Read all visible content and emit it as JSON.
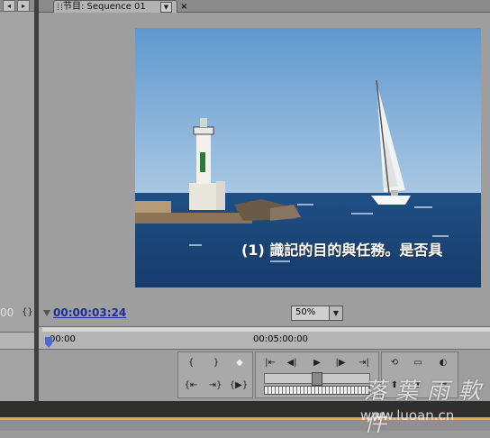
{
  "tab": {
    "title": "节目: Sequence 01",
    "menu_icon": "dropdown-arrow",
    "close": "×"
  },
  "preview": {
    "subtitle": "(1) 識記的目的與任務。是否具"
  },
  "timecode": {
    "current": "00:00:03:24",
    "left_partial": "00"
  },
  "zoom": {
    "value": "50%",
    "arrow": "▼"
  },
  "ruler": {
    "start": "00:00",
    "mid": "00:05:00:00"
  },
  "controls": {
    "mark_in": "{",
    "mark_out": "}",
    "marker": "◆",
    "go_in": "|⇤",
    "step_back": "◀|",
    "play": "▶",
    "step_fwd": "|▶",
    "go_out": "⇥|",
    "loop": "⟲",
    "safe": "▭",
    "output": "◐",
    "go_prev_edit": "{⇤",
    "go_next_edit": "⇥}",
    "play_in_out": "{▶}",
    "lift": "⬆",
    "extract": "⬆",
    "export": "⇄"
  },
  "watermark": {
    "brand": "落 葉 雨 軟 件",
    "url": "www.luoan.cn"
  }
}
